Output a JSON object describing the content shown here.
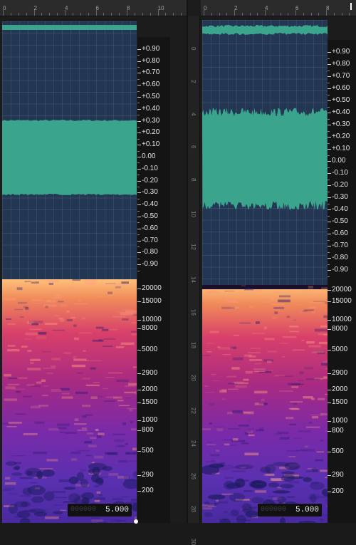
{
  "left": {
    "ruler_labels": [
      "0",
      "2",
      "4",
      "6",
      "8",
      "10"
    ],
    "amplitude_labels": [
      "+0.90",
      "+0.80",
      "+0.70",
      "+0.60",
      "+0.50",
      "+0.40",
      "+0.30",
      "+0.20",
      "+0.10",
      "0.00",
      "-0.10",
      "-0.20",
      "-0.30",
      "-0.40",
      "-0.50",
      "-0.60",
      "-0.70",
      "-0.80",
      "-0.90"
    ],
    "freq_labels": [
      "20000",
      "15000",
      "10000",
      "8000",
      "5000",
      "2900",
      "2000",
      "1500",
      "1000",
      "800",
      "500",
      "290",
      "200"
    ],
    "time_dim": "000000",
    "time_value": "5.000"
  },
  "right": {
    "ruler_labels": [
      "0",
      "2",
      "4",
      "6",
      "8"
    ],
    "vruler_labels": [
      "0",
      "2",
      "4",
      "6",
      "8",
      "10",
      "12",
      "14",
      "16",
      "18",
      "20",
      "22",
      "24",
      "26",
      "28",
      "30"
    ],
    "amplitude_labels": [
      "+0.90",
      "+0.80",
      "+0.70",
      "+0.60",
      "+0.50",
      "+0.40",
      "+0.30",
      "+0.20",
      "+0.10",
      "0.00",
      "-0.10",
      "-0.20",
      "-0.30",
      "-0.40",
      "-0.50",
      "-0.60",
      "-0.70",
      "-0.80",
      "-0.90"
    ],
    "freq_labels": [
      "20000",
      "15000",
      "10000",
      "8000",
      "5000",
      "2900",
      "2000",
      "1500",
      "1000",
      "800",
      "500",
      "290",
      "200"
    ],
    "time_dim": "000000",
    "time_value": "5.000"
  },
  "colors": {
    "wave_bg": "#233652",
    "wave_fill": "#3aa58c",
    "spec_hot": "#ffb070",
    "spec_mid": "#c02a6a",
    "spec_cool": "#5a2a9a"
  },
  "icons": [
    "playhead-marker-icon",
    "handle-icon"
  ]
}
